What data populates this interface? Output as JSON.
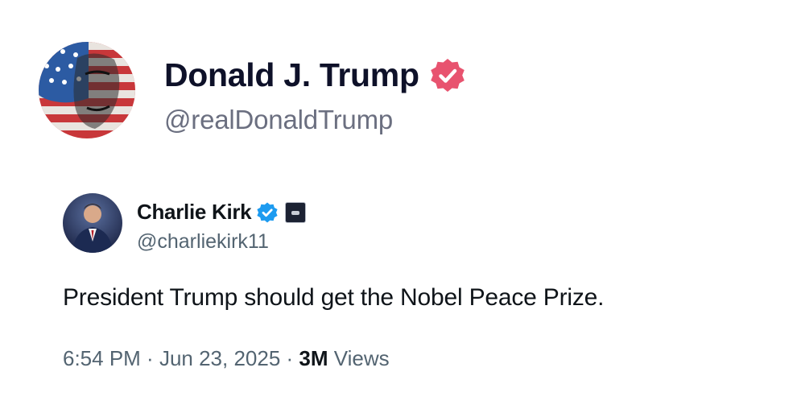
{
  "post": {
    "author": {
      "display_name": "Donald J. Trump",
      "handle": "@realDonaldTrump",
      "verified_badge_color": "#e8536f"
    }
  },
  "quoted_tweet": {
    "author": {
      "display_name": "Charlie Kirk",
      "handle": "@charliekirk11",
      "verified_badge_color": "#1d9bf0"
    },
    "text": "President Trump should get the Nobel Peace Prize.",
    "time": "6:54 PM",
    "separator": " · ",
    "date": "Jun 23, 2025",
    "views_count": "3M",
    "views_label": "Views"
  },
  "colors": {
    "name_dark": "#0e1129",
    "handle_gray": "#6b6f80",
    "meta_gray": "#536471"
  }
}
